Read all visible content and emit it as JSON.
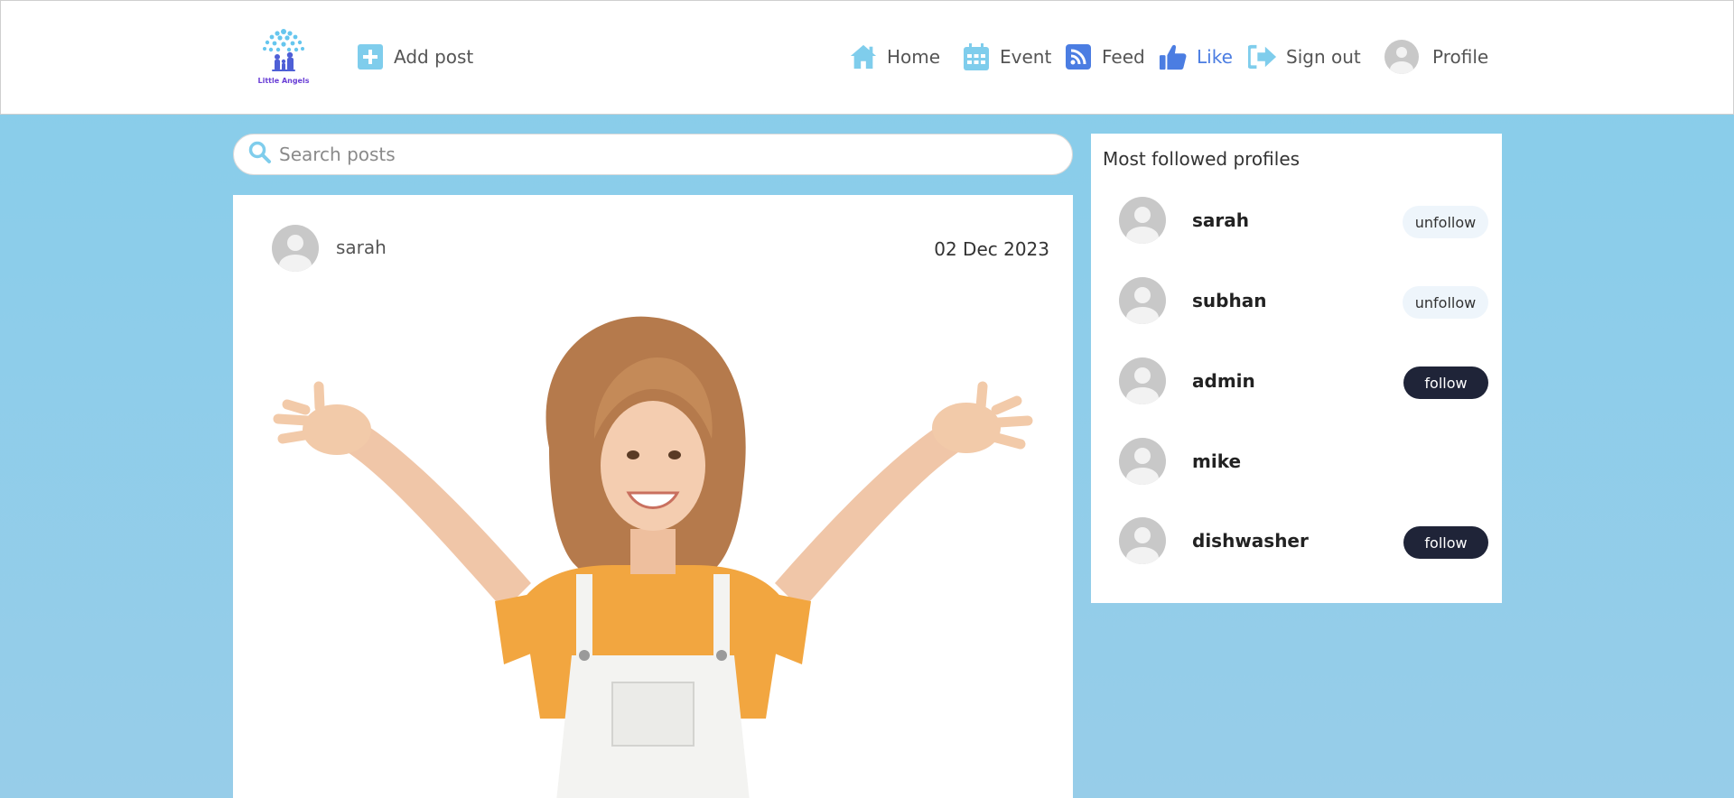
{
  "header": {
    "logo_text": "Little Angels",
    "add_post": "Add post",
    "nav": {
      "home": "Home",
      "event": "Event",
      "feed": "Feed",
      "like": "Like",
      "signout": "Sign out",
      "profile": "Profile"
    },
    "active_item": "Like",
    "accent_color": "#4b7de2",
    "icon_color": "#7fcdec"
  },
  "search": {
    "placeholder": "Search posts"
  },
  "post": {
    "author": "sarah",
    "date": "02 Dec 2023",
    "image": "smiling girl with open arms"
  },
  "sidebar": {
    "title": "Most followed profiles",
    "profiles": [
      {
        "name": "sarah",
        "action": "unfollow"
      },
      {
        "name": "subhan",
        "action": "unfollow"
      },
      {
        "name": "admin",
        "action": "follow"
      },
      {
        "name": "mike",
        "action": ""
      },
      {
        "name": "dishwasher",
        "action": "follow"
      }
    ]
  }
}
